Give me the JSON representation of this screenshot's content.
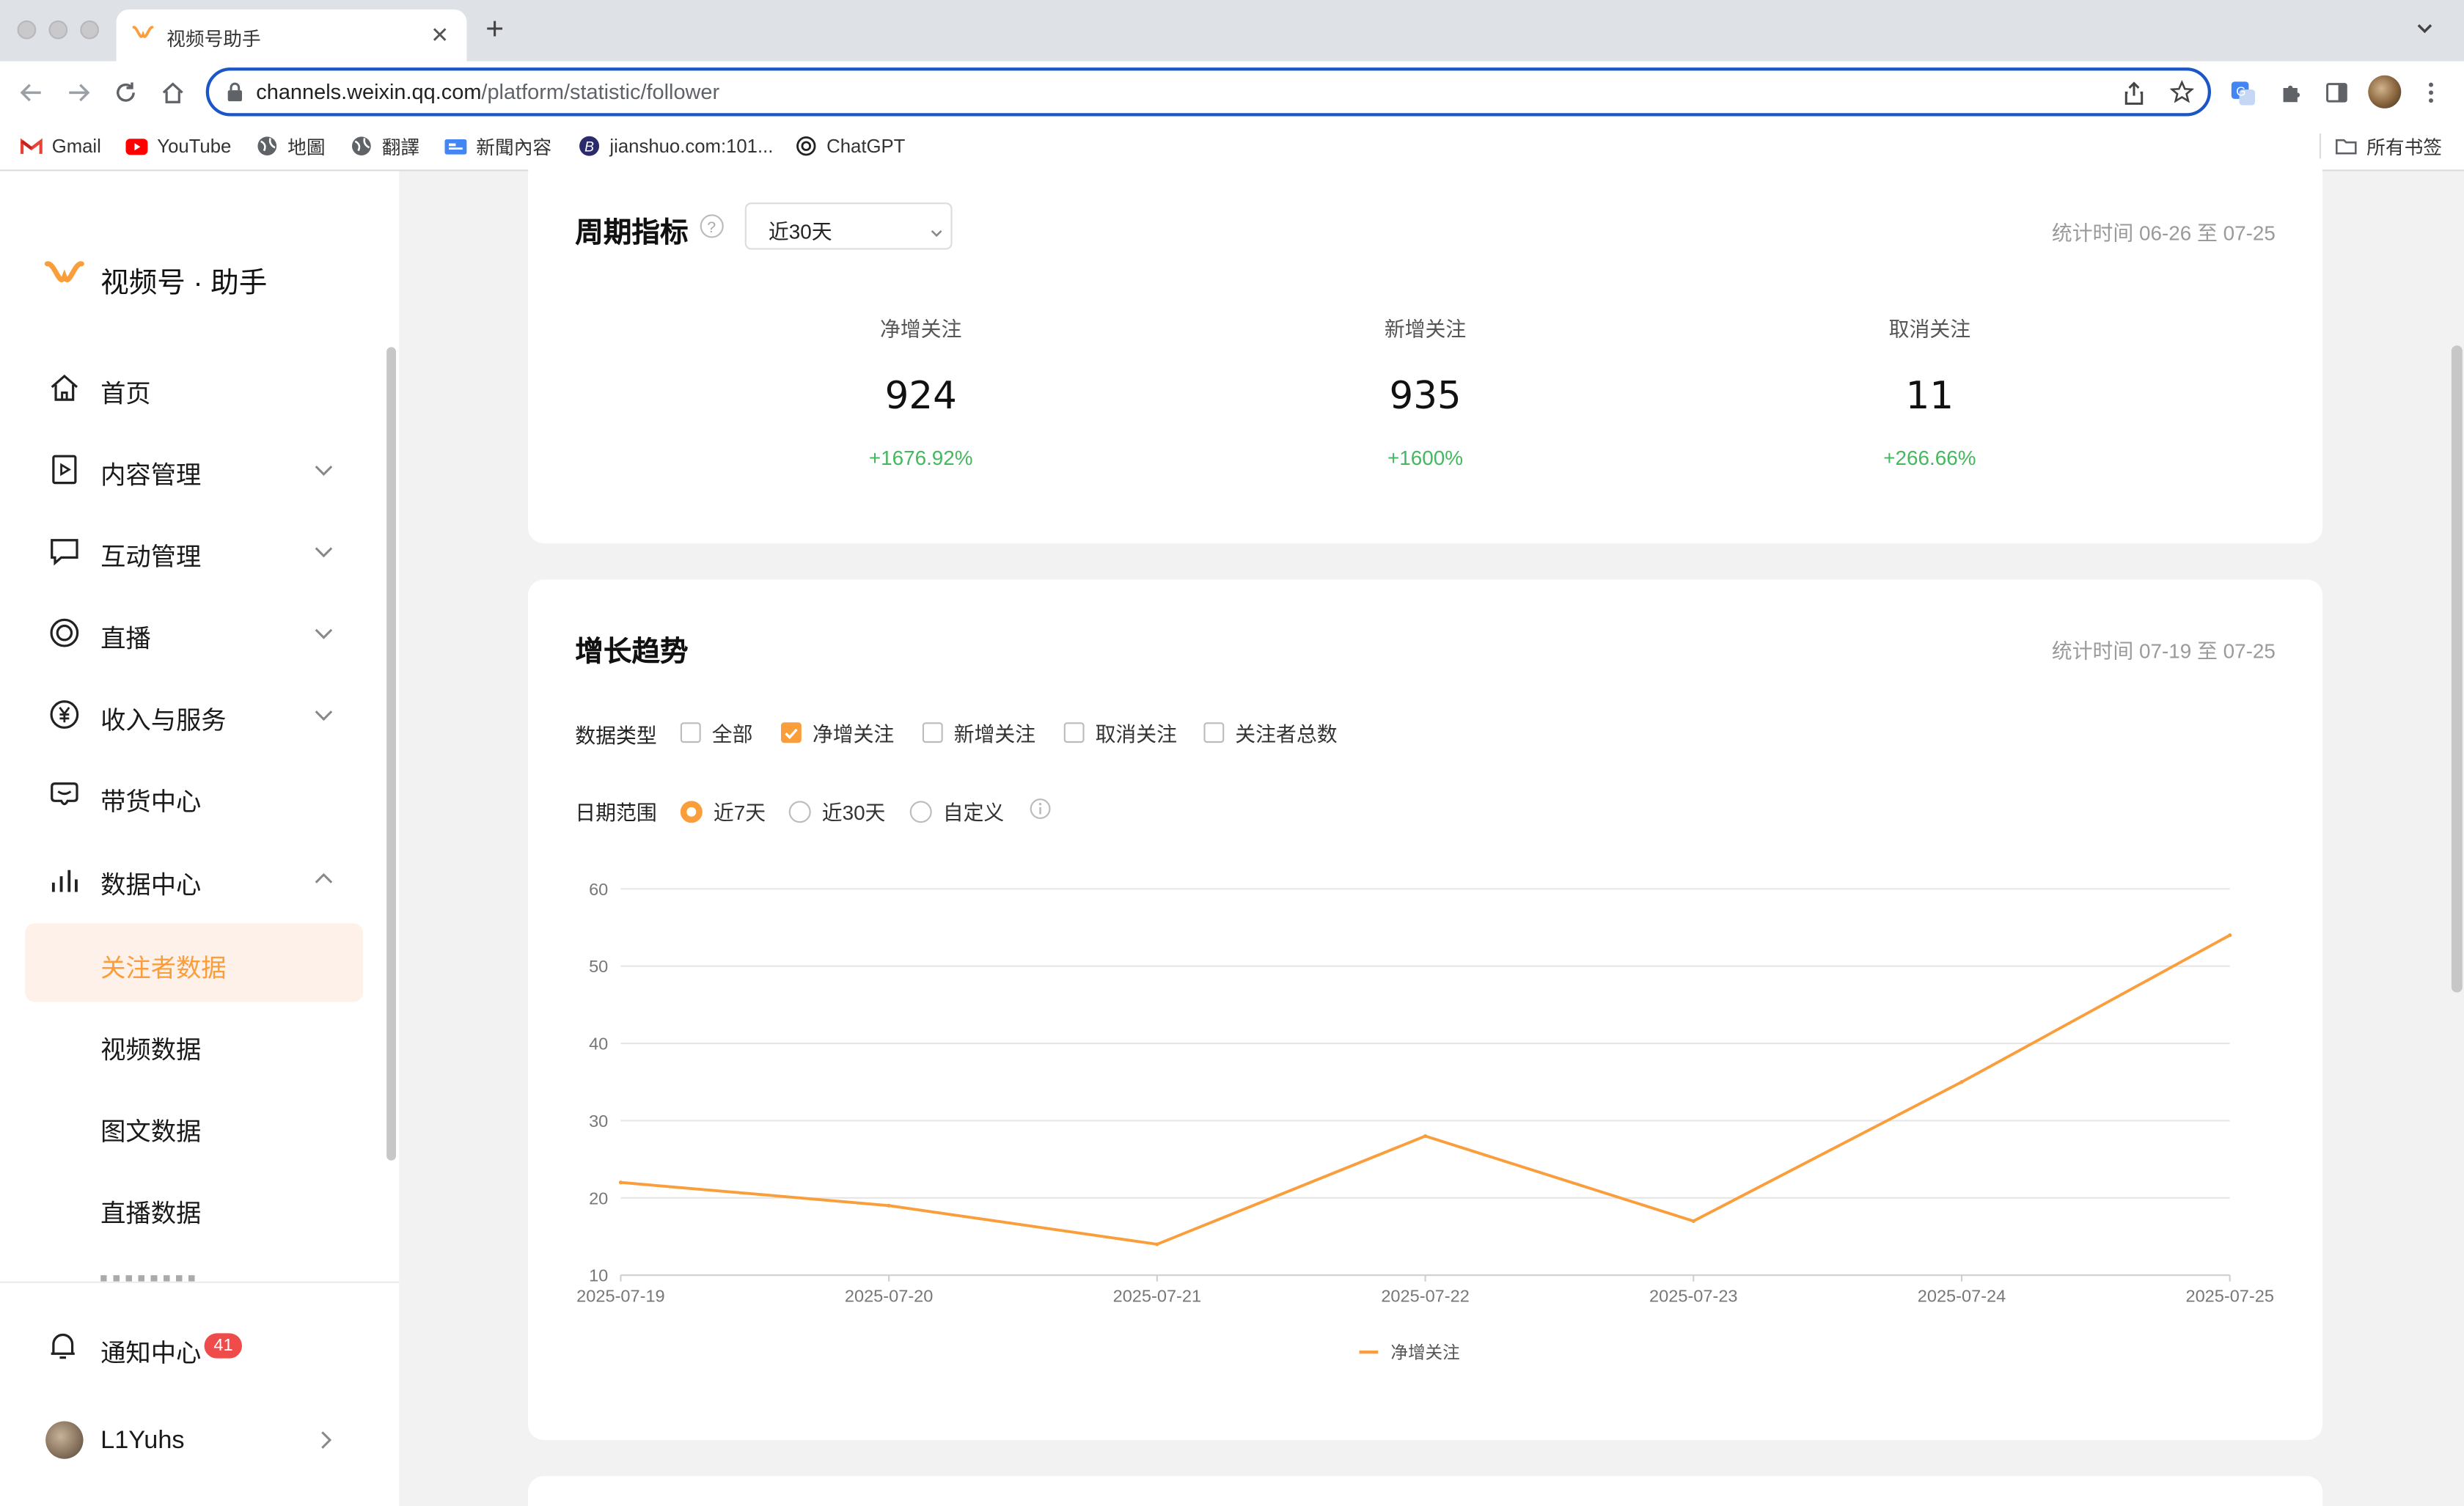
{
  "browser": {
    "tab_title": "视频号助手",
    "url_host": "channels.weixin.qq.com",
    "url_path": "/platform/statistic/follower",
    "bookmarks": [
      {
        "label": "Gmail",
        "icon": "gmail-icon"
      },
      {
        "label": "YouTube",
        "icon": "youtube-icon"
      },
      {
        "label": "地圖",
        "icon": "globe-icon"
      },
      {
        "label": "翻譯",
        "icon": "globe-icon"
      },
      {
        "label": "新聞內容",
        "icon": "google-news-icon"
      },
      {
        "label": "jianshuo.com:101...",
        "icon": "b-icon"
      },
      {
        "label": "ChatGPT",
        "icon": "openai-icon"
      }
    ],
    "all_bookmarks": "所有书签"
  },
  "sidebar": {
    "brand": "视频号 · 助手",
    "items": [
      {
        "label": "首页",
        "icon": "home-icon"
      },
      {
        "label": "内容管理",
        "icon": "content-icon"
      },
      {
        "label": "互动管理",
        "icon": "comment-icon"
      },
      {
        "label": "直播",
        "icon": "live-icon"
      },
      {
        "label": "收入与服务",
        "icon": "yuan-icon"
      },
      {
        "label": "带货中心",
        "icon": "shop-icon"
      },
      {
        "label": "数据中心",
        "icon": "bar-chart-icon"
      }
    ],
    "sub_items": [
      "关注者数据",
      "视频数据",
      "图文数据",
      "直播数据"
    ],
    "notification_label": "通知中心",
    "notification_count": "41",
    "username": "L1Yuhs"
  },
  "period_card": {
    "title": "周期指标",
    "select_value": "近30天",
    "stat_time": "统计时间 06-26 至 07-25",
    "metrics": [
      {
        "label": "净增关注",
        "value": "924",
        "change": "+1676.92%"
      },
      {
        "label": "新增关注",
        "value": "935",
        "change": "+1600%"
      },
      {
        "label": "取消关注",
        "value": "11",
        "change": "+266.66%"
      }
    ]
  },
  "trend_card": {
    "title": "增长趋势",
    "stat_time": "统计时间 07-19 至 07-25",
    "data_type_label": "数据类型",
    "data_types": [
      {
        "label": "全部",
        "checked": false
      },
      {
        "label": "净增关注",
        "checked": true
      },
      {
        "label": "新增关注",
        "checked": false
      },
      {
        "label": "取消关注",
        "checked": false
      },
      {
        "label": "关注者总数",
        "checked": false
      }
    ],
    "date_range_label": "日期范围",
    "date_ranges": [
      {
        "label": "近7天",
        "selected": true
      },
      {
        "label": "近30天",
        "selected": false
      },
      {
        "label": "自定义",
        "selected": false
      }
    ]
  },
  "colors": {
    "accent": "#fa9d3b",
    "positive": "#45b85f",
    "badge": "#f04b4b"
  },
  "chart_data": {
    "type": "line",
    "x": [
      "2025-07-19",
      "2025-07-20",
      "2025-07-21",
      "2025-07-22",
      "2025-07-23",
      "2025-07-24",
      "2025-07-25"
    ],
    "series": [
      {
        "name": "净增关注",
        "values": [
          22,
          19,
          14,
          28,
          17,
          35,
          54
        ]
      }
    ],
    "yticks": [
      10,
      20,
      30,
      40,
      50,
      60
    ],
    "ylim": [
      10,
      60
    ],
    "grid": true,
    "legend": "bottom-center"
  }
}
